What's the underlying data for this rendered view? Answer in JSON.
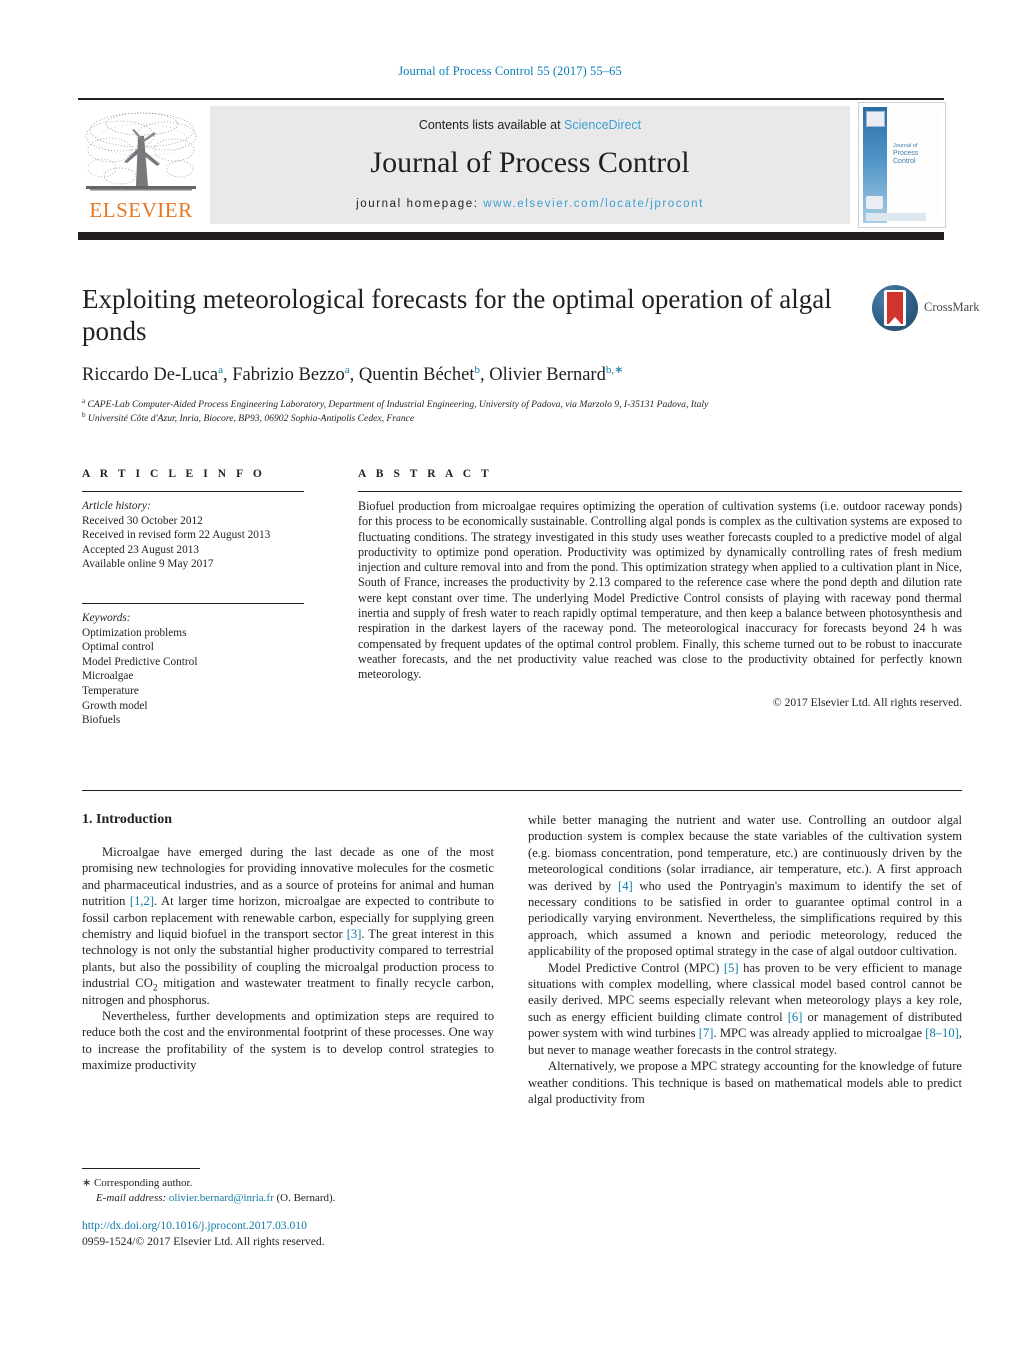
{
  "running_head": "Journal of Process Control 55 (2017) 55–65",
  "masthead": {
    "contents_prefix": "Contents lists available at ",
    "contents_link": "ScienceDirect",
    "journal_name": "Journal of Process Control",
    "homepage_prefix": "journal homepage:",
    "homepage_url": "www.elsevier.com/locate/jprocont",
    "publisher": "ELSEVIER",
    "cover_title_small": "Journal of",
    "cover_title_big": "Process Control"
  },
  "crossmark": {
    "label": "CrossMark"
  },
  "article": {
    "title": "Exploiting meteorological forecasts for the optimal operation of algal ponds",
    "authors": [
      {
        "name": "Riccardo De-Luca",
        "marks": "a",
        "sep": ", "
      },
      {
        "name": "Fabrizio Bezzo",
        "marks": "a",
        "sep": ", "
      },
      {
        "name": "Quentin Béchet",
        "marks": "b",
        "sep": ", "
      },
      {
        "name": "Olivier Bernard",
        "marks": "b,∗",
        "sep": ""
      }
    ],
    "affiliations": [
      {
        "mark": "a",
        "text": "CAPE-Lab Computer-Aided Process Engineering Laboratory, Department of Industrial Engineering, University of Padova, via Marzolo 9, I-35131 Padova, Italy"
      },
      {
        "mark": "b",
        "text": "Université Côte d'Azur, Inria, Biocore, BP93, 06902 Sophia-Antipolis Cedex, France"
      }
    ]
  },
  "article_info": {
    "heading": "A R T I C L E   I N F O",
    "history_label": "Article history:",
    "history": [
      "Received 30 October 2012",
      "Received in revised form 22 August 2013",
      "Accepted 23 August 2013",
      "Available online 9 May 2017"
    ],
    "keywords_label": "Keywords:",
    "keywords": [
      "Optimization problems",
      "Optimal control",
      "Model Predictive Control",
      "Microalgae",
      "Temperature",
      "Growth model",
      "Biofuels"
    ]
  },
  "abstract": {
    "heading": "A B S T R A C T",
    "body": "Biofuel production from microalgae requires optimizing the operation of cultivation systems (i.e. outdoor raceway ponds) for this process to be economically sustainable. Controlling algal ponds is complex as the cultivation systems are exposed to fluctuating conditions. The strategy investigated in this study uses weather forecasts coupled to a predictive model of algal productivity to optimize pond operation. Productivity was optimized by dynamically controlling rates of fresh medium injection and culture removal into and from the pond. This optimization strategy when applied to a cultivation plant in Nice, South of France, increases the productivity by 2.13 compared to the reference case where the pond depth and dilution rate were kept constant over time. The underlying Model Predictive Control consists of playing with raceway pond thermal inertia and supply of fresh water to reach rapidly optimal temperature, and then keep a balance between photosynthesis and respiration in the darkest layers of the raceway pond. The meteorological inaccuracy for forecasts beyond 24 h was compensated by frequent updates of the optimal control problem. Finally, this scheme turned out to be robust to inaccurate weather forecasts, and the net productivity value reached was close to the productivity obtained for perfectly known meteorology.",
    "copyright": "© 2017 Elsevier Ltd. All rights reserved."
  },
  "introduction": {
    "heading": "1.  Introduction",
    "left_paragraphs": [
      {
        "parts": [
          {
            "t": "Microalgae have emerged during the last decade as one of the most promising new technologies for providing innovative molecules for the cosmetic and pharmaceutical industries, and as a source of proteins for animal and human nutrition "
          },
          {
            "t": "[1,2]",
            "ref": true
          },
          {
            "t": ". At larger time horizon, microalgae are expected to contribute to fossil carbon replacement with renewable carbon, especially for supplying green chemistry and liquid biofuel in the transport sector "
          },
          {
            "t": "[3]",
            "ref": true
          },
          {
            "t": ". The great interest in this technology is not only the substantial higher productivity compared to terrestrial plants, but also the possibility of coupling the microalgal production process to industrial CO"
          },
          {
            "t": "2",
            "sub": true
          },
          {
            "t": " mitigation and wastewater treatment to finally recycle carbon, nitrogen and phosphorus."
          }
        ]
      },
      {
        "parts": [
          {
            "t": "Nevertheless, further developments and optimization steps are required to reduce both the cost and the environmental footprint of these processes. One way to increase the profitability of the system is to develop control strategies to maximize productivity"
          }
        ]
      }
    ],
    "right_paragraphs": [
      {
        "noindent": true,
        "parts": [
          {
            "t": "while better managing the nutrient and water use. Controlling an outdoor algal production system is complex because the state variables of the cultivation system (e.g. biomass concentration, pond temperature, etc.) are continuously driven by the meteorological conditions (solar irradiance, air temperature, etc.). A first approach was derived by "
          },
          {
            "t": "[4]",
            "ref": true
          },
          {
            "t": " who used the Pontryagin's maximum to identify the set of necessary conditions to be satisfied in order to guarantee optimal control in a periodically varying environment. Nevertheless, the simplifications required by this approach, which assumed a known and periodic meteorology, reduced the applicability of the proposed optimal strategy in the case of algal outdoor cultivation."
          }
        ]
      },
      {
        "parts": [
          {
            "t": "Model Predictive Control (MPC) "
          },
          {
            "t": "[5]",
            "ref": true
          },
          {
            "t": " has proven to be very efficient to manage situations with complex modelling, where classical model based control cannot be easily derived. MPC seems especially relevant when meteorology plays a key role, such as energy efficient building climate control "
          },
          {
            "t": "[6]",
            "ref": true
          },
          {
            "t": " or management of distributed power system with wind turbines "
          },
          {
            "t": "[7]",
            "ref": true
          },
          {
            "t": ". MPC was already applied to microalgae "
          },
          {
            "t": "[8–10]",
            "ref": true
          },
          {
            "t": ", but never to manage weather forecasts in the control strategy."
          }
        ]
      },
      {
        "parts": [
          {
            "t": "Alternatively, we propose a MPC strategy accounting for the knowledge of future weather conditions. This technique is based on mathematical models able to predict algal productivity from"
          }
        ]
      }
    ]
  },
  "footnote": {
    "star": "∗",
    "corresponding": "Corresponding author.",
    "email_label": "E-mail address:",
    "email": "olivier.bernard@inria.fr",
    "email_suffix": "(O. Bernard)."
  },
  "doi": {
    "url": "http://dx.doi.org/10.1016/j.jprocont.2017.03.010",
    "issn_line": "0959-1524/© 2017 Elsevier Ltd. All rights reserved."
  },
  "colors": {
    "link": "#0f7ba8",
    "masthead_link": "#3d9fd6",
    "elsevier_orange": "#e87722",
    "rule_dark": "#231f20"
  }
}
